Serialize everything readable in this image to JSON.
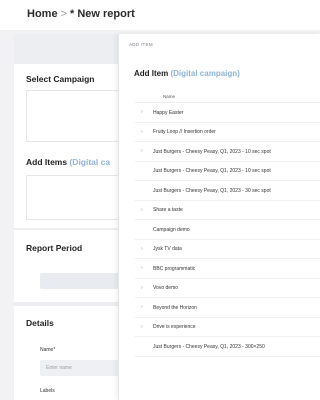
{
  "breadcrumb": {
    "home": "Home",
    "separator": ">",
    "current": "* New report"
  },
  "background_sections": {
    "select_campaign": "Select Campaign",
    "add_items": {
      "label": "Add Items",
      "accent": "(Digital ca"
    },
    "report_period": "Report Period",
    "details": "Details",
    "name_label": "Name*",
    "name_placeholder": "Enter name",
    "labels_label": "Labels"
  },
  "panel": {
    "kicker": "ADD ITEM",
    "title": "Add Item",
    "title_accent": "(Digital campaign)",
    "column_header": "Name",
    "rows": [
      {
        "text": "Happy Easter",
        "expandable": true
      },
      {
        "text": "Fruity Loop // Insertion order",
        "expandable": true
      },
      {
        "text": "Just Burgers - Cheesy Peasy, Q1, 2023 - 10 sec spot",
        "expandable": true
      },
      {
        "text": "Just Burgers - Cheesy Peasy, Q1, 2023 - 10 sec spot",
        "expandable": false
      },
      {
        "text": "Just Burgers - Cheesy Peasy, Q1, 2023 - 30 sec spot",
        "expandable": false
      },
      {
        "text": "Share a taste",
        "expandable": true
      },
      {
        "text": "Campaign demo",
        "expandable": false
      },
      {
        "text": "Jysk TV data",
        "expandable": true
      },
      {
        "text": "BBC programmatic",
        "expandable": true
      },
      {
        "text": "Vovo demo",
        "expandable": true
      },
      {
        "text": "Beyond the Horizon",
        "expandable": true
      },
      {
        "text": "Drive is experience",
        "expandable": true
      },
      {
        "text": "Just Burgers - Cheesy Peasy, Q1, 2023 - 300×250",
        "expandable": false
      }
    ]
  },
  "colors": {
    "accent": "#8fb3d9",
    "background": "#f2f2f4",
    "panel": "#ffffff"
  },
  "icons": {
    "expand": "chevron-right-icon"
  }
}
